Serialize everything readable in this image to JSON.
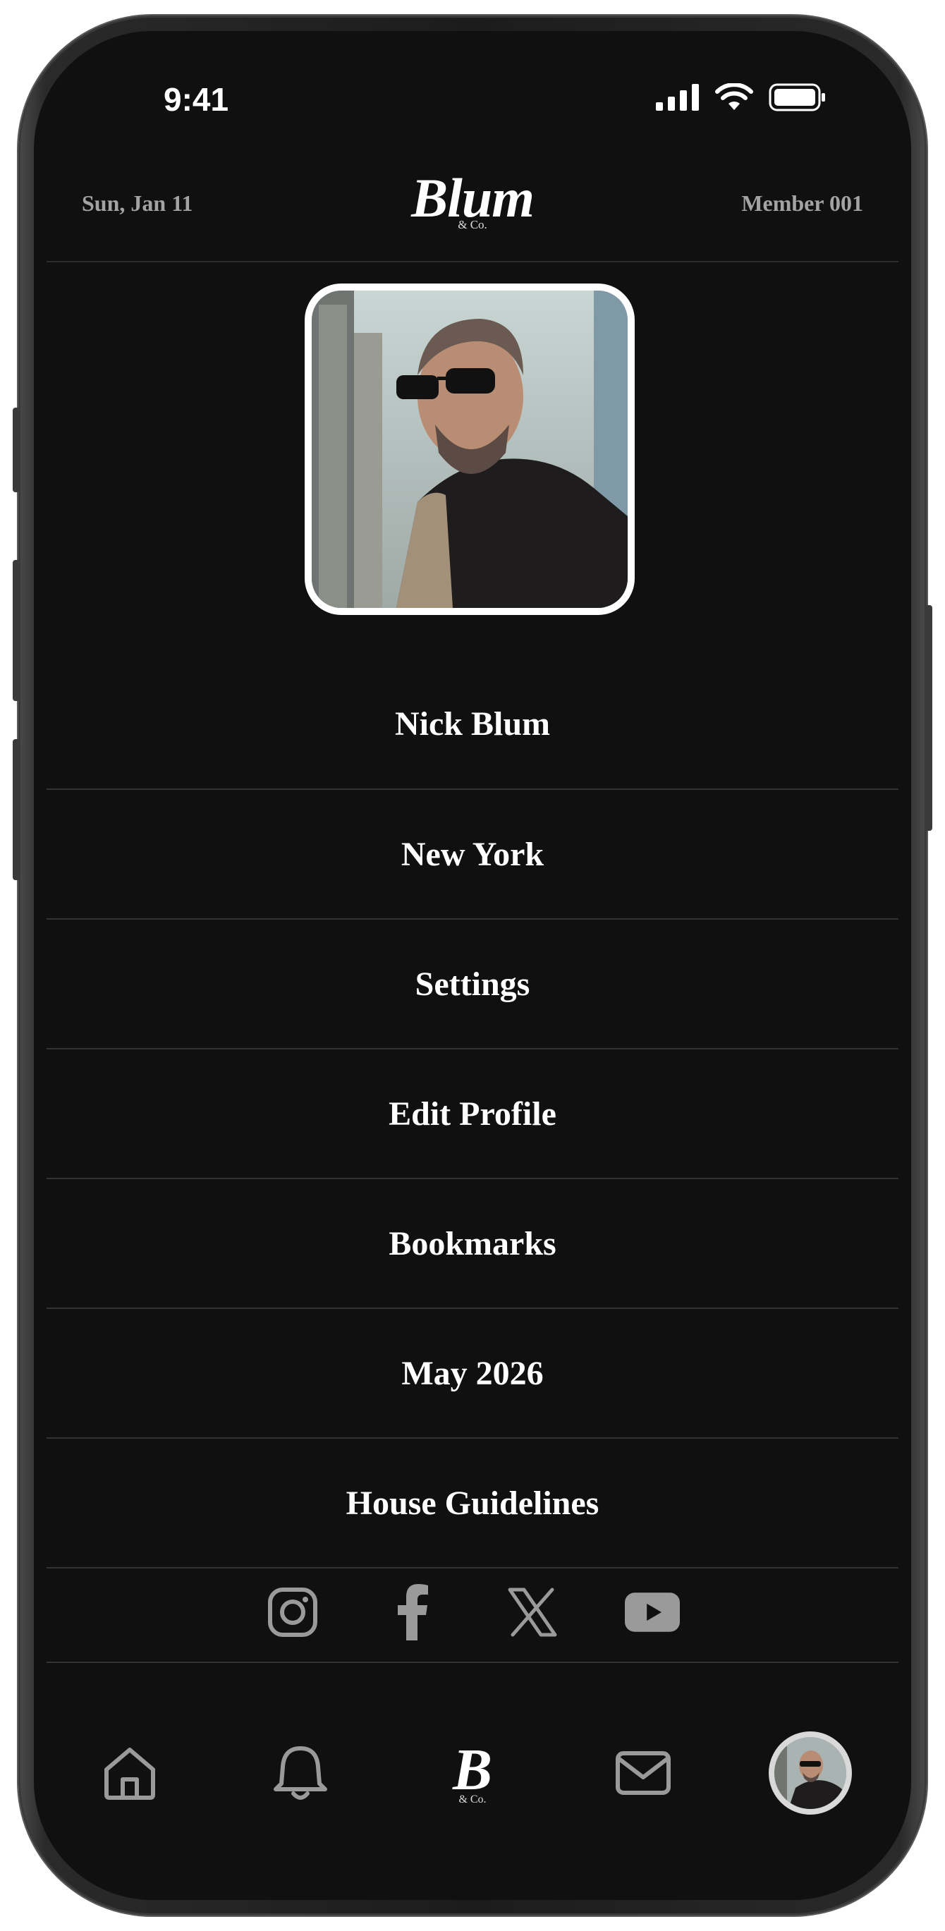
{
  "status_bar": {
    "time": "9:41"
  },
  "header": {
    "date": "Sun, Jan 11",
    "logo_main": "Blum",
    "logo_sub": "& Co.",
    "member": "Member 001"
  },
  "menu": {
    "items": [
      {
        "label": "Nick Blum"
      },
      {
        "label": "New York"
      },
      {
        "label": "Settings"
      },
      {
        "label": "Edit Profile"
      },
      {
        "label": "Bookmarks"
      },
      {
        "label": "May 2026"
      },
      {
        "label": "House Guidelines"
      }
    ]
  },
  "socials": [
    "instagram-icon",
    "facebook-icon",
    "x-icon",
    "youtube-icon"
  ],
  "tab_bar": {
    "logo_main": "B",
    "logo_sub": "& Co.",
    "icons": [
      "home-icon",
      "bell-icon",
      "brand-logo",
      "mail-icon",
      "profile-avatar"
    ]
  },
  "colors": {
    "screen_bg": "#101010",
    "divider": "#333333",
    "muted_text": "#a3a3a3",
    "icon_gray": "#9a9a9a"
  }
}
